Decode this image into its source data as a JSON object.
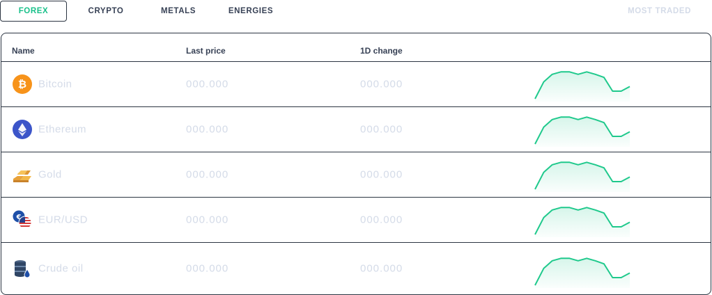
{
  "tabs": [
    {
      "label": "FOREX",
      "active": true
    },
    {
      "label": "CRYPTO",
      "active": false
    },
    {
      "label": "METALS",
      "active": false
    },
    {
      "label": "ENERGIES",
      "active": false
    }
  ],
  "most_traded_label": "MOST TRADED",
  "table": {
    "headers": {
      "name": "Name",
      "last_price": "Last price",
      "change_1d": "1D change"
    },
    "rows": [
      {
        "name": "Bitcoin",
        "icon": "bitcoin-icon",
        "last_price": "000.000",
        "change_1d": "000.000"
      },
      {
        "name": "Ethereum",
        "icon": "ethereum-icon",
        "last_price": "000.000",
        "change_1d": "000.000"
      },
      {
        "name": "Gold",
        "icon": "gold-bars-icon",
        "last_price": "000.000",
        "change_1d": "000.000"
      },
      {
        "name": "EUR/USD",
        "icon": "eur-usd-icon",
        "last_price": "000.000",
        "change_1d": "000.000"
      },
      {
        "name": "Crude oil",
        "icon": "oil-barrel-icon",
        "last_price": "000.000",
        "change_1d": "000.000"
      }
    ]
  },
  "sparkline": {
    "values": [
      0,
      0.55,
      0.8,
      0.88,
      0.88,
      0.8,
      0.88,
      0.8,
      0.7,
      0.25,
      0.25,
      0.4
    ],
    "color": "#1fc98c"
  },
  "colors": {
    "accent": "#19c08a",
    "border": "#2b3441",
    "muted_text": "#d4dbe8"
  }
}
